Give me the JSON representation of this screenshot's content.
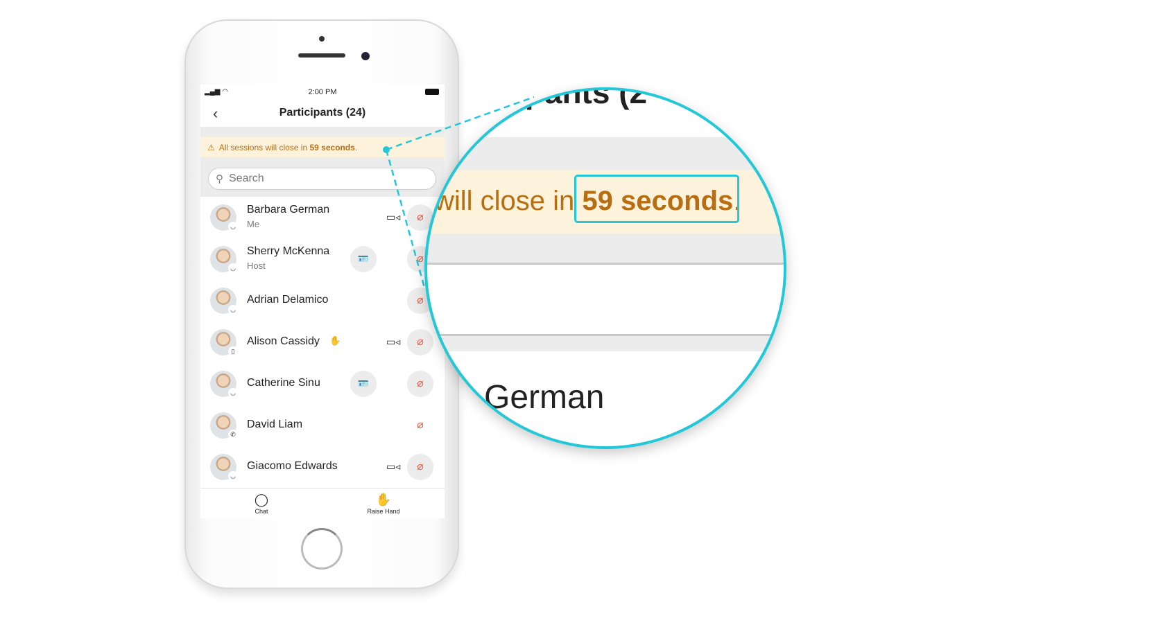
{
  "status_bar": {
    "time": "2:00 PM"
  },
  "header": {
    "title": "Participants (24)",
    "back_icon": "chevron-left-icon"
  },
  "banner": {
    "prefix": "All sessions will close in ",
    "highlight": "59 seconds",
    "suffix": ".",
    "icon": "warning-triangle-icon",
    "color": "#b86e10",
    "background": "#fdf3dd"
  },
  "search": {
    "placeholder": "Search"
  },
  "participants": [
    {
      "name": "Barbara German",
      "role": "Me",
      "video": true,
      "card": false,
      "mic": "muted"
    },
    {
      "name": "Sherry McKenna",
      "role": "Host",
      "video": false,
      "card": true,
      "mic": "muted"
    },
    {
      "name": "Adrian Delamico",
      "role": "",
      "video": false,
      "card": false,
      "mic": "muted"
    },
    {
      "name": "Alison Cassidy",
      "role": "",
      "video": true,
      "card": false,
      "mic": "muted",
      "hand_raised": true
    },
    {
      "name": "Catherine Sinu",
      "role": "",
      "video": false,
      "card": true,
      "mic": "muted"
    },
    {
      "name": "David Liam",
      "role": "",
      "video": false,
      "card": false,
      "mic": "muted"
    },
    {
      "name": "Giacomo Edwards",
      "role": "",
      "video": true,
      "card": false,
      "mic": "muted"
    }
  ],
  "tabbar": {
    "chat": "Chat",
    "raise_hand": "Raise Hand"
  },
  "magnifier": {
    "title_fragment": "ipants (2",
    "banner_fragment": "will close in ",
    "highlight": "59 seconds",
    "suffix": ".",
    "name_fragment": "German",
    "accent": "#22c8d8"
  }
}
